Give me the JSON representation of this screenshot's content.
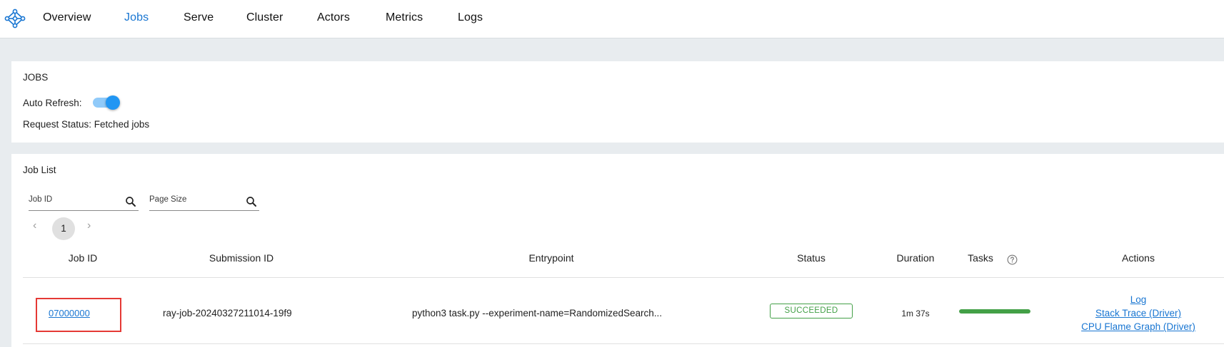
{
  "nav": {
    "items": [
      "Overview",
      "Jobs",
      "Serve",
      "Cluster",
      "Actors",
      "Metrics",
      "Logs"
    ],
    "active": "Jobs"
  },
  "jobs_panel": {
    "title": "JOBS",
    "auto_refresh_label": "Auto Refresh:",
    "auto_refresh_on": true,
    "request_status": "Request Status: Fetched jobs"
  },
  "job_list": {
    "title": "Job List",
    "filters": {
      "job_id_placeholder": "Job ID",
      "page_size_placeholder": "Page Size"
    },
    "pagination": {
      "prev": "‹",
      "current_page": "1",
      "next": "›"
    },
    "columns": [
      "Job ID",
      "Submission ID",
      "Entrypoint",
      "Status",
      "Duration",
      "Tasks",
      "Actions"
    ],
    "rows": [
      {
        "job_id": "07000000",
        "submission_id": "ray-job-20240327211014-19f9",
        "entrypoint": "python3 task.py --experiment-name=RandomizedSearch...",
        "status": "SUCCEEDED",
        "duration": "1m 37s",
        "tasks_progress": 1.0,
        "actions": [
          "Log",
          "Stack Trace (Driver)",
          "CPU Flame Graph (Driver)"
        ]
      }
    ]
  },
  "colors": {
    "accent": "#1976d2",
    "success": "#43a047",
    "highlight": "#e53935"
  }
}
